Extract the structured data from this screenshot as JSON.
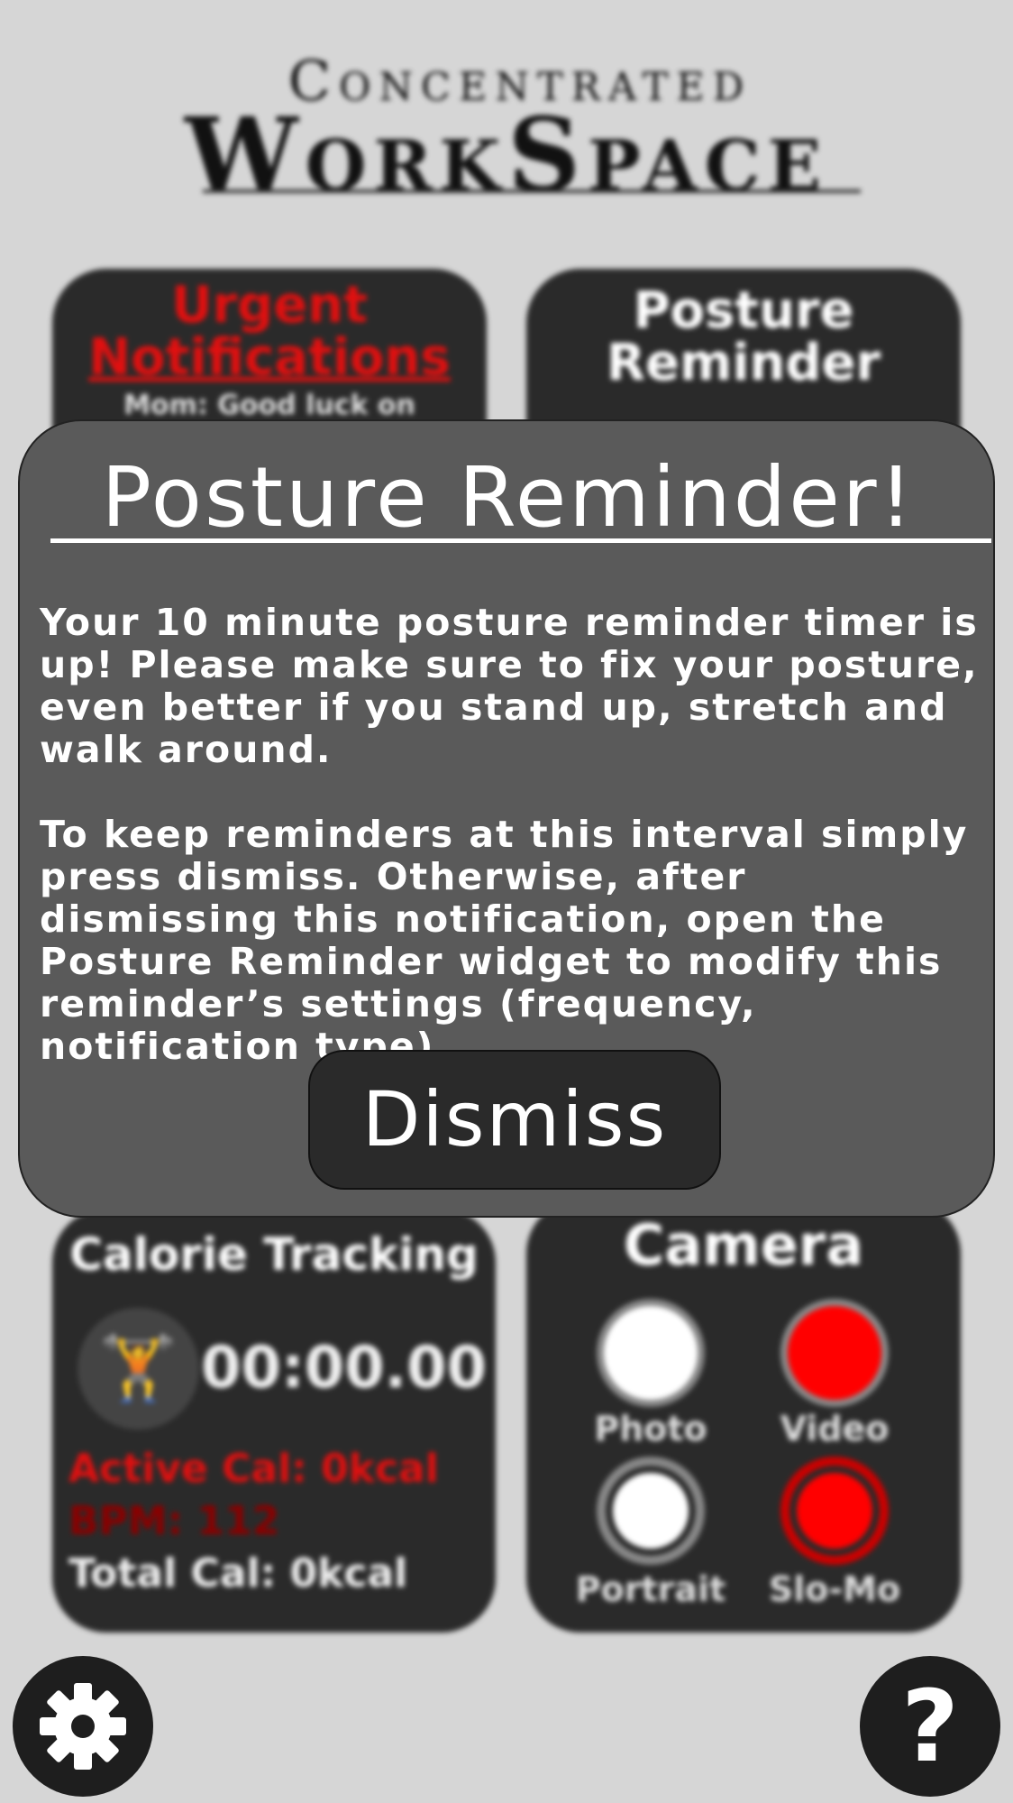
{
  "app": {
    "logo_line1": "Concentrated",
    "logo_line2": "WorkSpace"
  },
  "tiles": {
    "urgent": {
      "title_line1": "Urgent",
      "title_line2": "Notifications",
      "message_preview": "Mom: Good luck on"
    },
    "posture": {
      "title_line1": "Posture",
      "title_line2": "Reminder"
    },
    "calorie": {
      "title": "Calorie Tracking",
      "timer": "00:00.00",
      "active_cal": "Active Cal: 0kcal",
      "bpm": "BPM: 112",
      "total_cal": "Total Cal: 0kcal",
      "icon": "weightlifter-icon"
    },
    "camera": {
      "title": "Camera",
      "photo_label": "Photo",
      "video_label": "Video",
      "portrait_label": "Portrait",
      "slomo_label": "Slo-Mo"
    }
  },
  "bottom": {
    "settings_icon": "gear-icon",
    "help_glyph": "?"
  },
  "modal": {
    "title": "Posture Reminder!",
    "paragraph1": "Your 10 minute posture reminder timer is up! Please make sure to fix your posture, even better if you stand up, stretch and walk around.",
    "paragraph2": "To keep reminders at this interval simply press dismiss. Otherwise, after dismissing this notification, open the Posture Reminder widget to modify this reminder’s settings (frequency, notification type).",
    "dismiss_label": "Dismiss"
  },
  "colors": {
    "background": "#d6d6d6",
    "tile": "#2a2a2a",
    "modal": "#5a5a5a",
    "accent_red": "#e01010"
  }
}
